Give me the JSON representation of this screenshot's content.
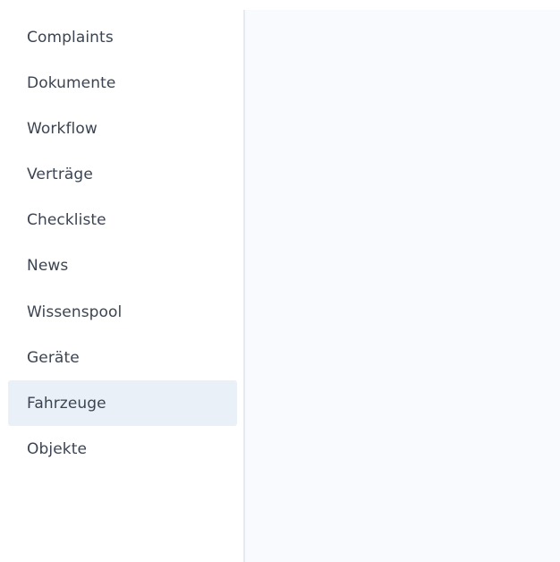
{
  "sidebar": {
    "active_index": 8,
    "items": [
      {
        "label": "Complaints"
      },
      {
        "label": "Dokumente"
      },
      {
        "label": "Workflow"
      },
      {
        "label": "Verträge"
      },
      {
        "label": "Checkliste"
      },
      {
        "label": "News"
      },
      {
        "label": "Wissenspool"
      },
      {
        "label": "Geräte"
      },
      {
        "label": "Fahrzeuge"
      },
      {
        "label": "Objekte"
      }
    ]
  },
  "colors": {
    "active_background": "#e9f0f7",
    "text": "#3c4452",
    "content_background": "#f9fafd",
    "divider": "#e7ebf0"
  }
}
